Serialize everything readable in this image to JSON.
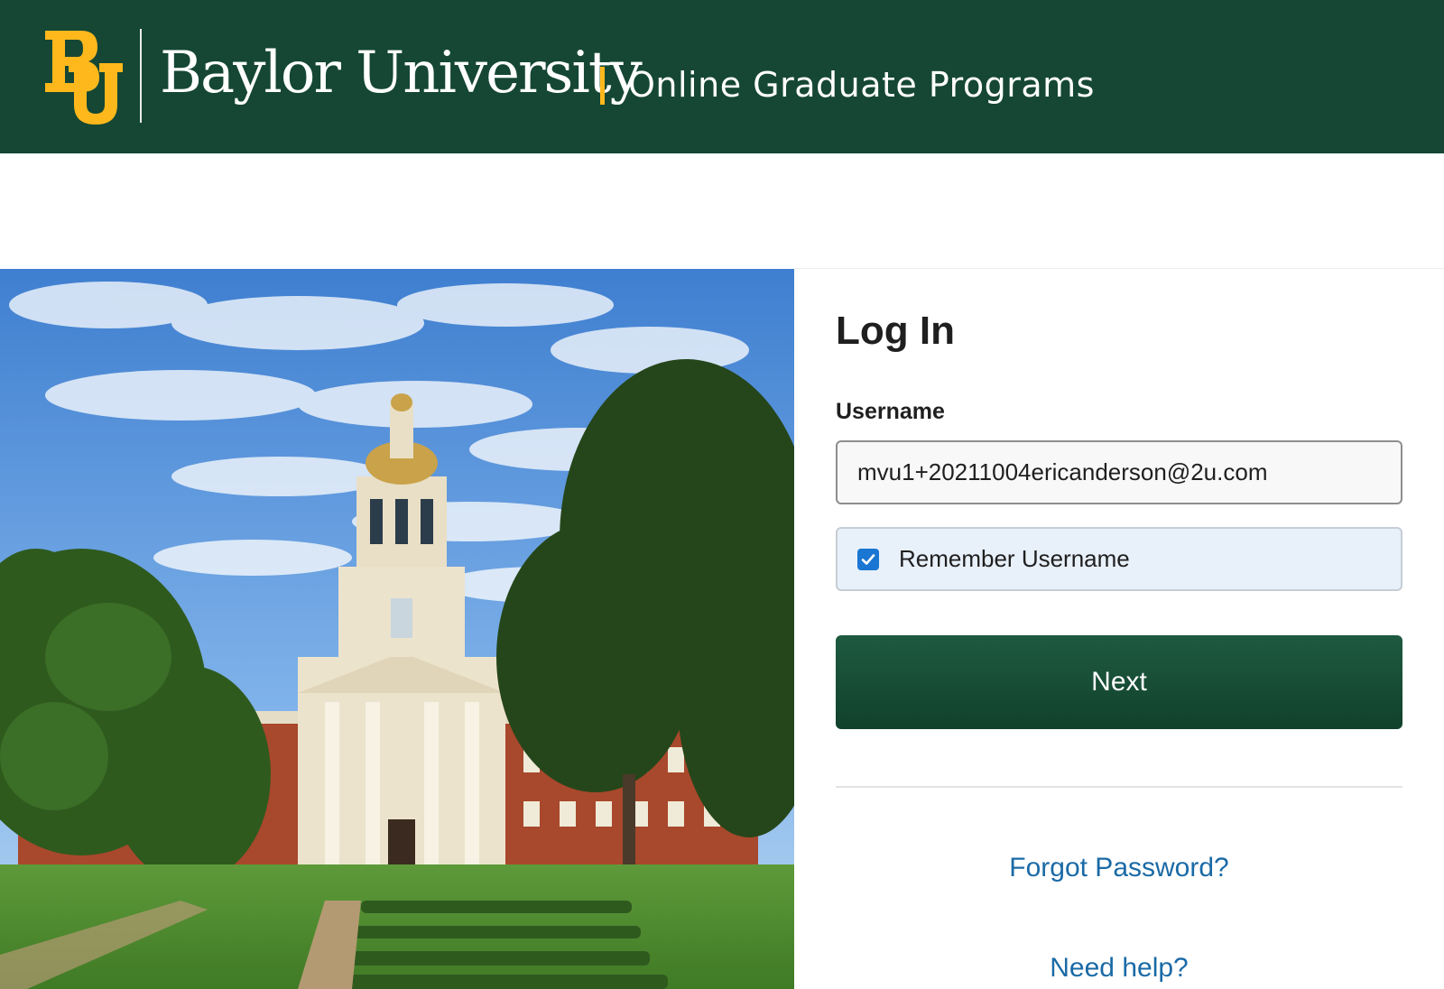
{
  "header": {
    "logo_icon": "bu-monogram-icon",
    "brand_name": "Baylor University",
    "subtitle": "Online Graduate Programs",
    "colors": {
      "background": "#154734",
      "accent": "#FFB81C"
    }
  },
  "hero": {
    "image": "campus-building-photo"
  },
  "login": {
    "title": "Log In",
    "username_label": "Username",
    "username_value": "mvu1+20211004ericanderson@2u.com",
    "remember_label": "Remember Username",
    "remember_checked": true,
    "next_label": "Next",
    "forgot_label": "Forgot Password?",
    "help_label": "Need help?",
    "colors": {
      "button": "#154734",
      "link": "#1a6aa6",
      "checkbox": "#1976d2"
    }
  }
}
